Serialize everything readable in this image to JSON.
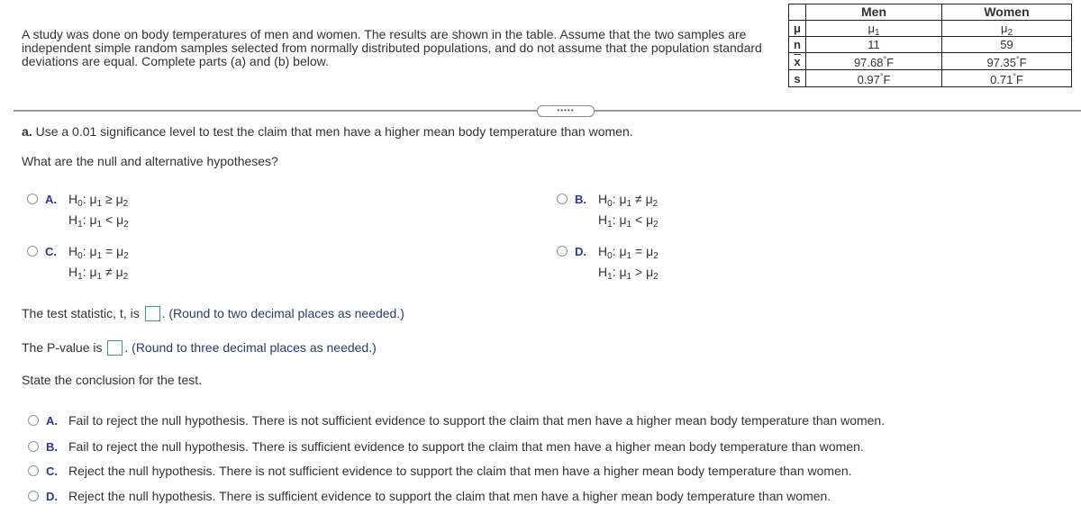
{
  "intro": "A study was done on body temperatures of men and women. The results are shown in the table. Assume that the two samples are independent simple random samples selected from normally distributed populations, and do not assume that the population standard deviations are equal. Complete parts (a) and (b) below.",
  "table": {
    "headers": [
      "",
      "Men",
      "Women"
    ],
    "rows": [
      {
        "label": "μ",
        "men": "μ",
        "men_sub": "1",
        "women": "μ",
        "women_sub": "2"
      },
      {
        "label": "n",
        "men": "11",
        "women": "59"
      },
      {
        "label": "x",
        "men": "97.68",
        "women": "97.35"
      },
      {
        "label": "s",
        "men": "0.97",
        "women": "0.71"
      }
    ],
    "unit": "F",
    "degree": "°"
  },
  "expander_label": "•••••",
  "part_a": {
    "label": "a.",
    "text": "Use a 0.01 significance level to test the claim that men have a higher mean body temperature than women."
  },
  "hyp_question": "What are the null and alternative hypotheses?",
  "hypothesis_options": [
    {
      "letter": "A.",
      "h0": "≥",
      "h1": "<"
    },
    {
      "letter": "B.",
      "h0": "≠",
      "h1": "<"
    },
    {
      "letter": "C.",
      "h0": "=",
      "h1": "≠"
    },
    {
      "letter": "D.",
      "h0": "=",
      "h1": ">"
    }
  ],
  "hyp_symbols": {
    "H": "H",
    "sub0": "0",
    "sub1": "1",
    "mu": "μ",
    "colon": ":"
  },
  "test_stat": {
    "prefix": "The test statistic, t, is",
    "value": "",
    "hint": ". (Round to two decimal places as needed.)"
  },
  "p_value": {
    "prefix": "The P-value is",
    "value": "",
    "hint": ". (Round to three decimal places as needed.)"
  },
  "conclusion_prompt": "State the conclusion for the test.",
  "conclusion_options": [
    {
      "letter": "A.",
      "text": "Fail to reject the null hypothesis. There is not sufficient evidence to support the claim that men have a higher mean body temperature than women."
    },
    {
      "letter": "B.",
      "text": "Fail to reject the null hypothesis. There is sufficient evidence to support the claim that men have a higher mean body temperature than women."
    },
    {
      "letter": "C.",
      "text": "Reject the null hypothesis. There is not sufficient evidence to support the claim that men have a higher mean body temperature than women."
    },
    {
      "letter": "D.",
      "text": "Reject the null hypothesis. There is sufficient evidence to support the claim that men have a higher mean body temperature than women."
    }
  ],
  "colors": {
    "letter": "#2d3a8c",
    "radio_border": "#8a97a8",
    "answer_box_border": "#4a8a9a"
  }
}
